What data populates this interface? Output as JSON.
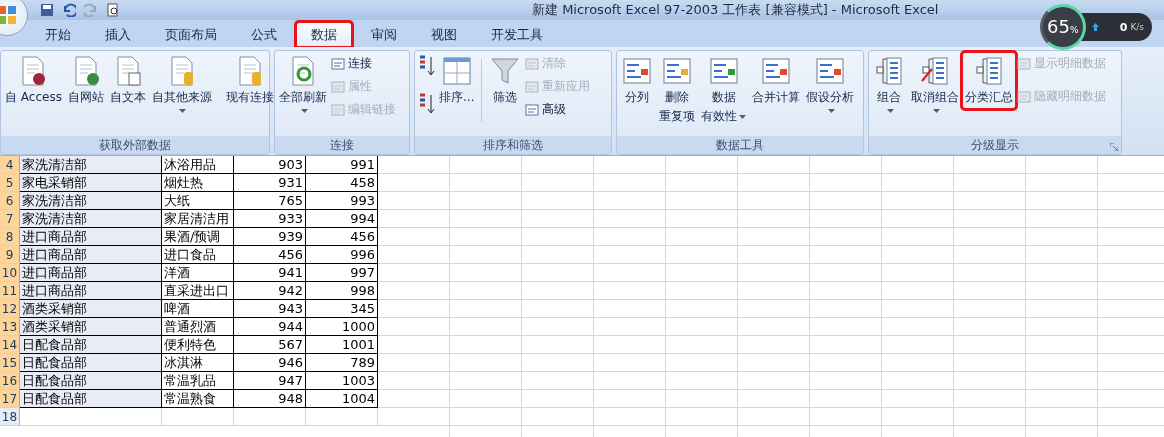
{
  "title_bar": {
    "title": "新建 Microsoft Excel 97-2003 工作表  [兼容模式] - Microsoft Excel"
  },
  "tabs": [
    {
      "label": "开始",
      "selected": false,
      "highlighted": false
    },
    {
      "label": "插入",
      "selected": false,
      "highlighted": false
    },
    {
      "label": "页面布局",
      "selected": false,
      "highlighted": false
    },
    {
      "label": "公式",
      "selected": false,
      "highlighted": false
    },
    {
      "label": "数据",
      "selected": true,
      "highlighted": true
    },
    {
      "label": "审阅",
      "selected": false,
      "highlighted": false
    },
    {
      "label": "视图",
      "selected": false,
      "highlighted": false
    },
    {
      "label": "开发工具",
      "selected": false,
      "highlighted": false
    }
  ],
  "ribbon": {
    "groups": [
      {
        "label": "获取外部数据",
        "items": [
          {
            "kind": "large",
            "label": "自 Access",
            "dropdown": false,
            "highlighted": false
          },
          {
            "kind": "large",
            "label": "自网站",
            "dropdown": false,
            "highlighted": false
          },
          {
            "kind": "large",
            "label": "自文本",
            "dropdown": false,
            "highlighted": false
          },
          {
            "kind": "large",
            "label": "自其他来源",
            "dropdown": true,
            "highlighted": false
          },
          {
            "kind": "separator"
          },
          {
            "kind": "large",
            "label": "现有连接",
            "dropdown": false,
            "highlighted": false
          }
        ]
      },
      {
        "label": "连接",
        "items": [
          {
            "kind": "large",
            "label": "全部刷新",
            "dropdown": true,
            "highlighted": false
          },
          {
            "kind": "small",
            "label": "连接",
            "disabled": false
          },
          {
            "kind": "small",
            "label": "属性",
            "disabled": true
          },
          {
            "kind": "small",
            "label": "编辑链接",
            "disabled": true
          }
        ]
      },
      {
        "label": "排序和筛选",
        "items": [
          {
            "kind": "sort_ascending"
          },
          {
            "kind": "sort_descending"
          },
          {
            "kind": "large",
            "label": "排序...",
            "dropdown": false,
            "highlighted": false
          },
          {
            "kind": "separator"
          },
          {
            "kind": "large",
            "label": "筛选",
            "dropdown": false,
            "highlighted": false
          },
          {
            "kind": "small",
            "label": "清除",
            "disabled": true
          },
          {
            "kind": "small",
            "label": "重新应用",
            "disabled": true
          },
          {
            "kind": "small",
            "label": "高级",
            "disabled": false
          }
        ]
      },
      {
        "label": "数据工具",
        "items": [
          {
            "kind": "large",
            "label": "分列",
            "dropdown": false,
            "highlighted": false
          },
          {
            "kind": "large",
            "label": "删除",
            "label_2": "重复项",
            "dropdown": false,
            "highlighted": false
          },
          {
            "kind": "large",
            "label": "数据",
            "label_2": "有效性",
            "dropdown": true,
            "highlighted": false
          },
          {
            "kind": "large",
            "label": "合并计算",
            "dropdown": false,
            "highlighted": false
          },
          {
            "kind": "large",
            "label": "假设分析",
            "dropdown": true,
            "highlighted": false
          }
        ]
      },
      {
        "label": "分级显示",
        "dialog_launcher": true,
        "items": [
          {
            "kind": "large",
            "label": "组合",
            "dropdown": true,
            "highlighted": false
          },
          {
            "kind": "large",
            "label": "取消组合",
            "dropdown": true,
            "highlighted": false
          },
          {
            "kind": "large",
            "label": "分类汇总",
            "dropdown": false,
            "highlighted": true
          },
          {
            "kind": "small",
            "label": "显示明细数据",
            "disabled": true
          },
          {
            "kind": "small",
            "label": "隐藏明细数据",
            "disabled": true
          }
        ]
      }
    ]
  },
  "monitor": {
    "percent": "65",
    "percent_sign": "%",
    "speed": "0",
    "unit": "K/s"
  },
  "sheet": {
    "rows": [
      {
        "header": "4",
        "selected": true,
        "cells": [
          "家洗清洁部",
          "沐浴用品",
          "903",
          "991"
        ]
      },
      {
        "header": "5",
        "selected": true,
        "cells": [
          "家电采销部",
          "烟灶热",
          "931",
          "458"
        ]
      },
      {
        "header": "6",
        "selected": true,
        "cells": [
          "家洗清洁部",
          "大纸",
          "765",
          "993"
        ]
      },
      {
        "header": "7",
        "selected": true,
        "cells": [
          "家洗清洁部",
          "家居清洁用",
          "933",
          "994"
        ]
      },
      {
        "header": "8",
        "selected": true,
        "cells": [
          "进口商品部",
          "果酒/预调",
          "939",
          "456"
        ]
      },
      {
        "header": "9",
        "selected": true,
        "cells": [
          "进口商品部",
          "进口食品",
          "456",
          "996"
        ]
      },
      {
        "header": "10",
        "selected": true,
        "cells": [
          "进口商品部",
          "洋酒",
          "941",
          "997"
        ]
      },
      {
        "header": "11",
        "selected": true,
        "cells": [
          "进口商品部",
          "直采进出口",
          "942",
          "998"
        ]
      },
      {
        "header": "12",
        "selected": true,
        "cells": [
          "酒类采销部",
          "啤酒",
          "943",
          "345"
        ]
      },
      {
        "header": "13",
        "selected": true,
        "cells": [
          "酒类采销部",
          "普通烈酒",
          "944",
          "1000"
        ]
      },
      {
        "header": "14",
        "selected": true,
        "cells": [
          "日配食品部",
          "便利特色",
          "567",
          "1001"
        ]
      },
      {
        "header": "15",
        "selected": true,
        "cells": [
          "日配食品部",
          "冰淇淋",
          "946",
          "789"
        ]
      },
      {
        "header": "16",
        "selected": true,
        "cells": [
          "日配食品部",
          "常温乳品",
          "947",
          "1003"
        ]
      },
      {
        "header": "17",
        "selected": true,
        "cells": [
          "日配食品部",
          "常温熟食",
          "948",
          "1004"
        ]
      },
      {
        "header": "18",
        "selected": false,
        "cells": [
          "",
          "",
          "",
          ""
        ]
      }
    ]
  }
}
